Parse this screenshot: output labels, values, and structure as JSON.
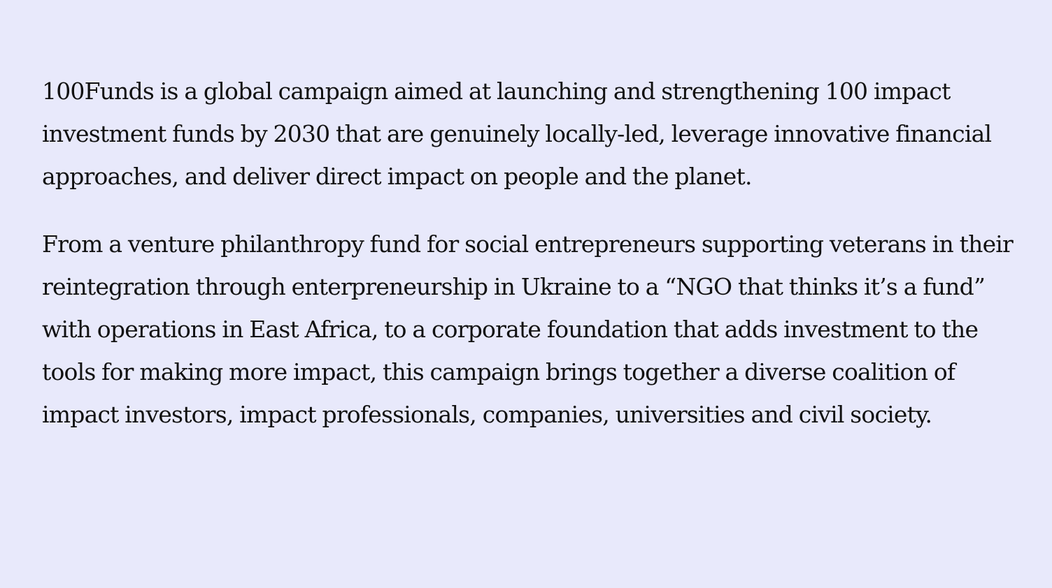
{
  "colors": {
    "background": "#e8e9fb",
    "text": "#111111"
  },
  "content": {
    "paragraphs": [
      "100Funds is a global campaign aimed at launching and strengthening 100 impact investment funds by 2030 that are genuinely locally-led, leverage innovative financial approaches, and deliver direct impact on people and the planet.",
      "From a venture philanthropy fund for social entrepreneurs supporting veterans in their reintegration through enterpreneurship in Ukraine to a “NGO that thinks it’s a fund” with operations in East Africa, to a corporate foundation that adds investment to the tools for making more impact, this campaign brings together a diverse coalition of impact investors, impact professionals, companies, universities and civil society."
    ]
  }
}
